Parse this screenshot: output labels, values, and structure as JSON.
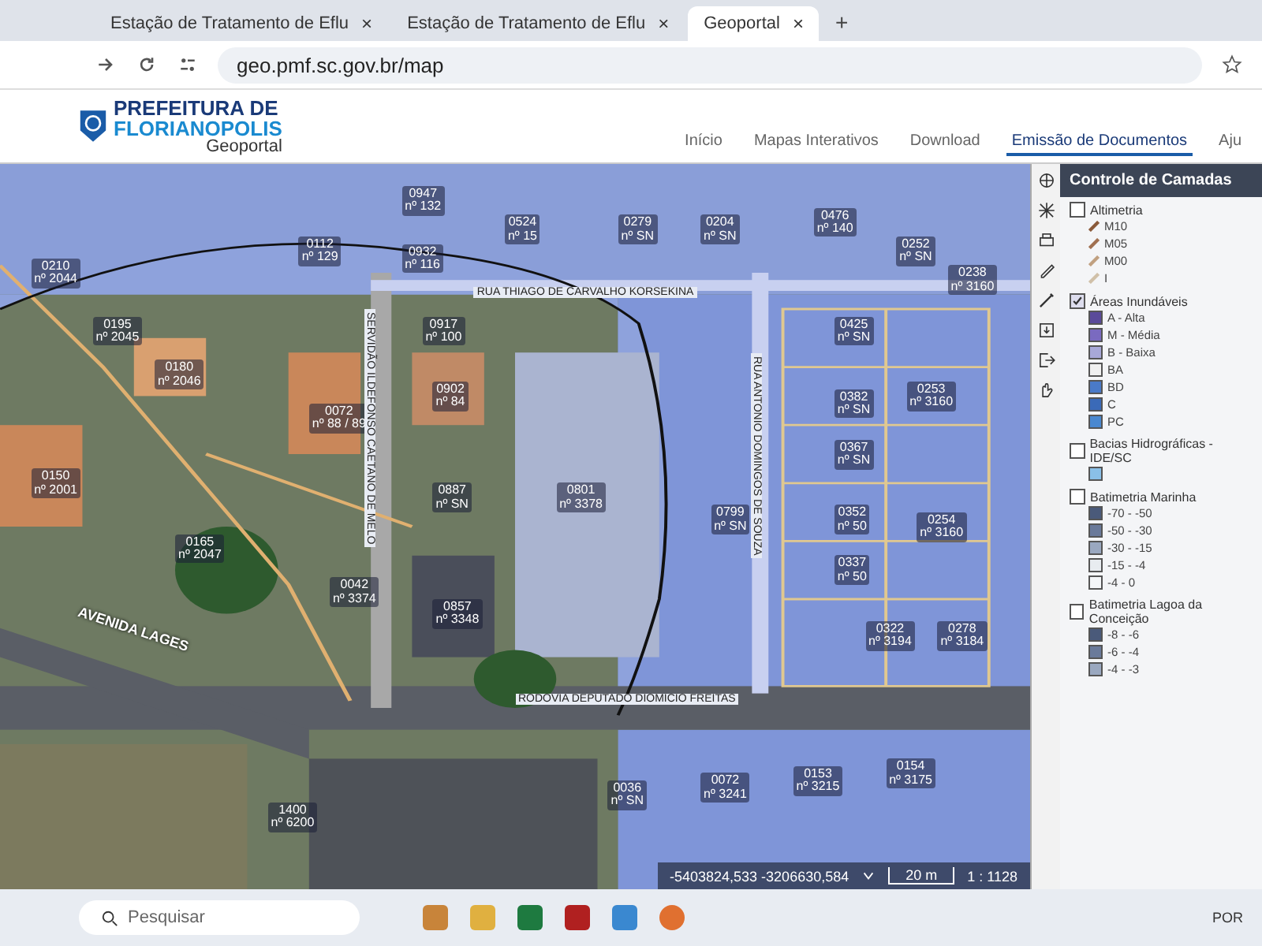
{
  "browser": {
    "tabs": [
      {
        "title": "Estação de Tratamento de Eflu",
        "close": "×",
        "selected": false
      },
      {
        "title": "Estação de Tratamento de Eflu",
        "close": "×",
        "selected": false
      },
      {
        "title": "Geoportal",
        "close": "×",
        "selected": true
      }
    ],
    "new_tab": "+",
    "address": "geo.pmf.sc.gov.br/map"
  },
  "header": {
    "logo_line_1": "PREFEITURA DE",
    "logo_line_2": "FLORIANOPOLIS",
    "logo_sub": "Geoportal",
    "nav": [
      {
        "label": "Início",
        "selected": false
      },
      {
        "label": "Mapas Interativos",
        "selected": false
      },
      {
        "label": "Download",
        "selected": false
      },
      {
        "label": "Emissão de Documentos",
        "selected": true
      },
      {
        "label": "Aju",
        "selected": false
      }
    ]
  },
  "map": {
    "parcels": [
      {
        "code": "0210",
        "number": "nº 2044"
      },
      {
        "code": "0195",
        "number": "nº 2045"
      },
      {
        "code": "0180",
        "number": "nº 2046"
      },
      {
        "code": "0150",
        "number": "nº 2001"
      },
      {
        "code": "0165",
        "number": "nº 2047"
      },
      {
        "code": "0112",
        "number": "nº 129"
      },
      {
        "code": "0947",
        "number": "nº 132"
      },
      {
        "code": "0932",
        "number": "nº 116"
      },
      {
        "code": "0524",
        "number": "nº 15"
      },
      {
        "code": "0279",
        "number": "nº SN"
      },
      {
        "code": "0204",
        "number": "nº SN"
      },
      {
        "code": "0476",
        "number": "nº 140"
      },
      {
        "code": "0252",
        "number": "nº SN"
      },
      {
        "code": "0238",
        "number": "nº 3160"
      },
      {
        "code": "0917",
        "number": "nº 100"
      },
      {
        "code": "0072",
        "number": "nº 88 / 89"
      },
      {
        "code": "0902",
        "number": "nº 84"
      },
      {
        "code": "0887",
        "number": "nº SN"
      },
      {
        "code": "0042",
        "number": "nº 3374"
      },
      {
        "code": "0857",
        "number": "nº 3348"
      },
      {
        "code": "0801",
        "number": "nº 3378"
      },
      {
        "code": "0799",
        "number": "nº SN"
      },
      {
        "code": "0425",
        "number": "nº SN"
      },
      {
        "code": "0382",
        "number": "nº SN"
      },
      {
        "code": "0367",
        "number": "nº SN"
      },
      {
        "code": "0253",
        "number": "nº 3160"
      },
      {
        "code": "0352",
        "number": "nº 50"
      },
      {
        "code": "0254",
        "number": "nº 3160"
      },
      {
        "code": "0337",
        "number": "nº 50"
      },
      {
        "code": "0322",
        "number": "nº 3194"
      },
      {
        "code": "0278",
        "number": "nº 3184"
      },
      {
        "code": "0036",
        "number": "nº SN"
      },
      {
        "code": "0072",
        "number": "nº 3241"
      },
      {
        "code": "0153",
        "number": "nº 3215"
      },
      {
        "code": "0154",
        "number": "nº 3175"
      },
      {
        "code": "1400",
        "number": "nº 6200"
      }
    ],
    "streets": [
      {
        "name": "RUA THIAGO DE CARVALHO KORSEKINA",
        "kind": "horizontal"
      },
      {
        "name": "SERVIDÃO ILDEFONSO CAETANO DE MELO",
        "kind": "vertical"
      },
      {
        "name": "RUA ANTONIO DOMINGOS DE SOUZA",
        "kind": "vertical"
      },
      {
        "name": "AVENIDA LAGES",
        "kind": "diagonal"
      },
      {
        "name": "RODOVIA DEPUTADO DIOMICIO FREITAS",
        "kind": "horizontal"
      }
    ],
    "status": {
      "coordinates": "-5403824,533 -3206630,584",
      "scale_bar": "20 m",
      "scale": "1 : 1128"
    }
  },
  "layer_panel": {
    "title": "Controle de Camadas",
    "layers": [
      {
        "name": "Altimetria",
        "checked": false,
        "legend": [
          {
            "label": "M10",
            "kind": "line",
            "color": "#8a5a3a"
          },
          {
            "label": "M05",
            "kind": "line",
            "color": "#a07050"
          },
          {
            "label": "M00",
            "kind": "line",
            "color": "#c0a080"
          },
          {
            "label": "I",
            "kind": "line",
            "color": "#d0c0a8"
          }
        ]
      },
      {
        "name": "Áreas Inundáveis",
        "checked": true,
        "legend": [
          {
            "label": "A - Alta",
            "kind": "swatch",
            "color": "#5a4a9a"
          },
          {
            "label": "M - Média",
            "kind": "swatch",
            "color": "#7a6ac0"
          },
          {
            "label": "B - Baixa",
            "kind": "swatch",
            "color": "#a8a8d8"
          },
          {
            "label": "BA",
            "kind": "swatch",
            "color": "#f0f0f0"
          },
          {
            "label": "BD",
            "kind": "swatch",
            "color": "#4a7ac8"
          },
          {
            "label": "C",
            "kind": "swatch",
            "color": "#3a6ab8"
          },
          {
            "label": "PC",
            "kind": "swatch",
            "color": "#4a88d0"
          }
        ]
      },
      {
        "name": "Bacias Hidrográficas - IDE/SC",
        "checked": false,
        "legend": [
          {
            "kind": "swatch",
            "color": "#8ac0e8"
          }
        ]
      },
      {
        "name": "Batimetria Marinha",
        "checked": false,
        "legend": [
          {
            "label": "-70 - -50",
            "kind": "swatch",
            "color": "#4a5a7a"
          },
          {
            "label": "-50 - -30",
            "kind": "swatch",
            "color": "#6a7a9a"
          },
          {
            "label": "-30 - -15",
            "kind": "swatch",
            "color": "#9aa8c0"
          },
          {
            "label": "-15 - -4",
            "kind": "swatch",
            "color": "#e8ecf0"
          },
          {
            "label": "-4 - 0",
            "kind": "swatch",
            "color": "#f4f6f8"
          }
        ]
      },
      {
        "name": "Batimetria Lagoa da Conceição",
        "checked": false,
        "legend": [
          {
            "label": "-8 - -6",
            "kind": "swatch",
            "color": "#4a5a7a"
          },
          {
            "label": "-6 - -4",
            "kind": "swatch",
            "color": "#6a7a9a"
          },
          {
            "label": "-4 - -3",
            "kind": "swatch",
            "color": "#9aa8c0"
          }
        ]
      }
    ]
  },
  "taskbar": {
    "search_placeholder": "Pesquisar",
    "language": "POR"
  }
}
